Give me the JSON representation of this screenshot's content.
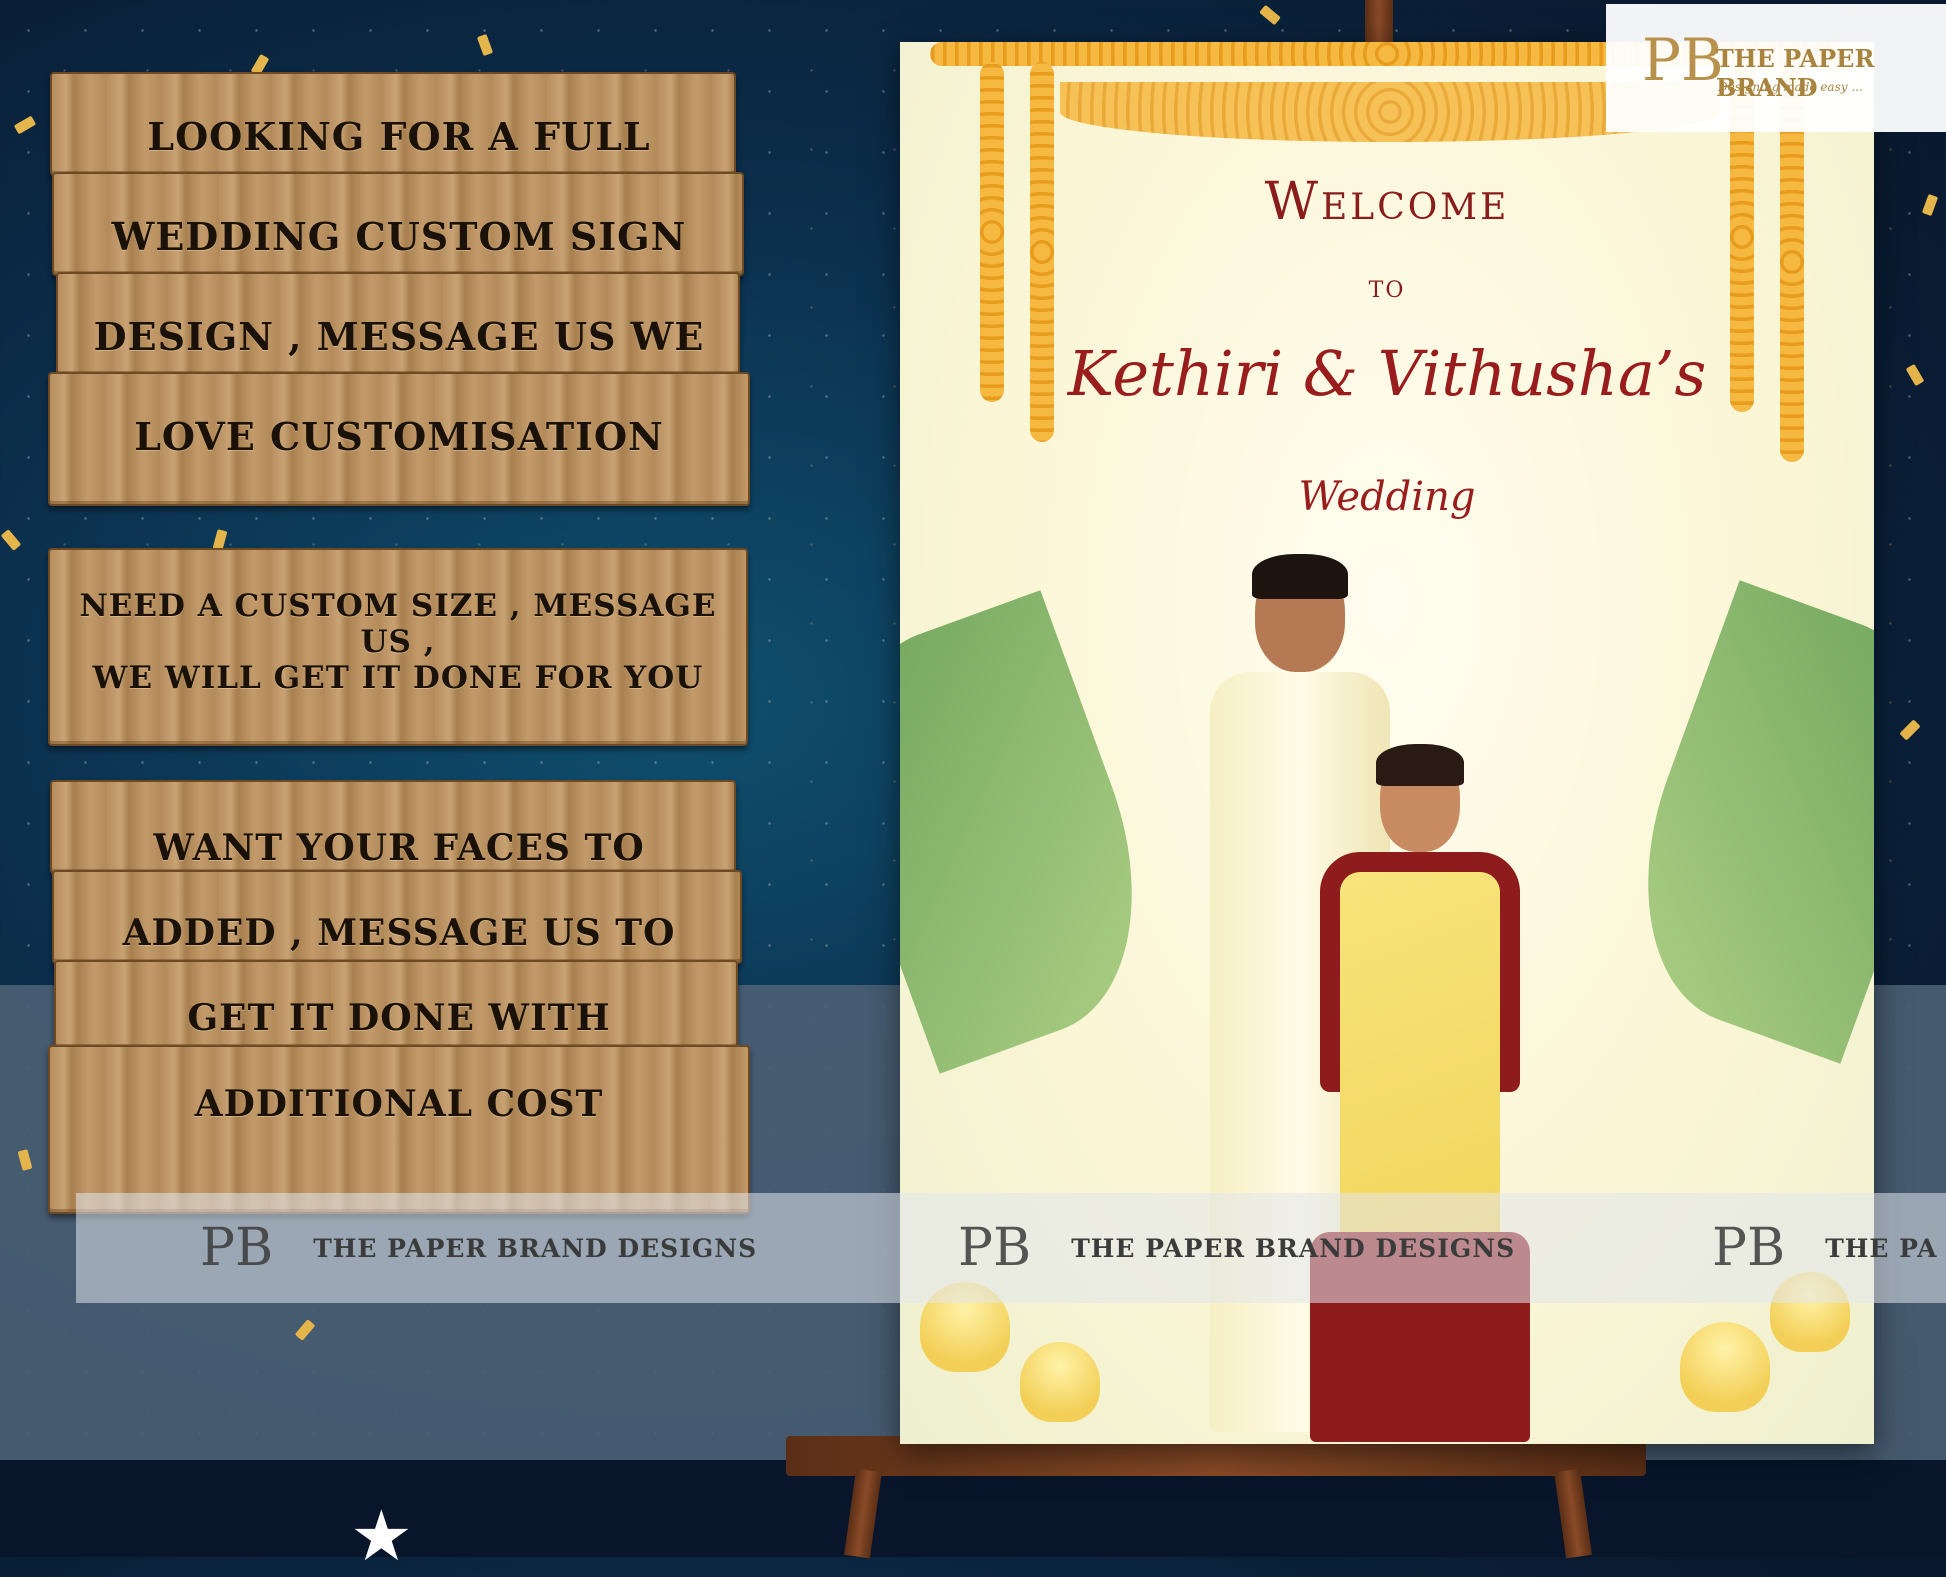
{
  "signs": {
    "sign1": {
      "lines": [
        "LOOKING FOR A FULL",
        "WEDDING CUSTOM SIGN",
        "DESIGN , MESSAGE US WE",
        "LOVE CUSTOMISATION"
      ]
    },
    "sign2": {
      "lines": [
        "NEED A CUSTOM SIZE , MESSAGE US ,",
        "WE WILL GET IT DONE FOR YOU"
      ]
    },
    "sign3": {
      "lines": [
        "WANT YOUR FACES TO",
        "ADDED , MESSAGE US TO",
        "GET IT DONE WITH",
        "ADDITIONAL COST"
      ]
    }
  },
  "poster": {
    "welcome": "Welcome",
    "to": "TO",
    "names": "Kethiri & Vithusha’s",
    "event": "Wedding"
  },
  "logo": {
    "mark": "PB",
    "name": "THE PAPER BRAND",
    "tagline": "Designing made easy ..."
  },
  "watermark": {
    "mark": "PB",
    "text_1": "THE PAPER BRAND DESIGNS",
    "text_2": "THE PAPER BRAND DESIGNS",
    "text_3": "THE PA"
  },
  "colors": {
    "background": "#0b2f4d",
    "wood": "#b58d5e",
    "poster_text": "#8a1c1c",
    "gold": "#e4b54a"
  }
}
